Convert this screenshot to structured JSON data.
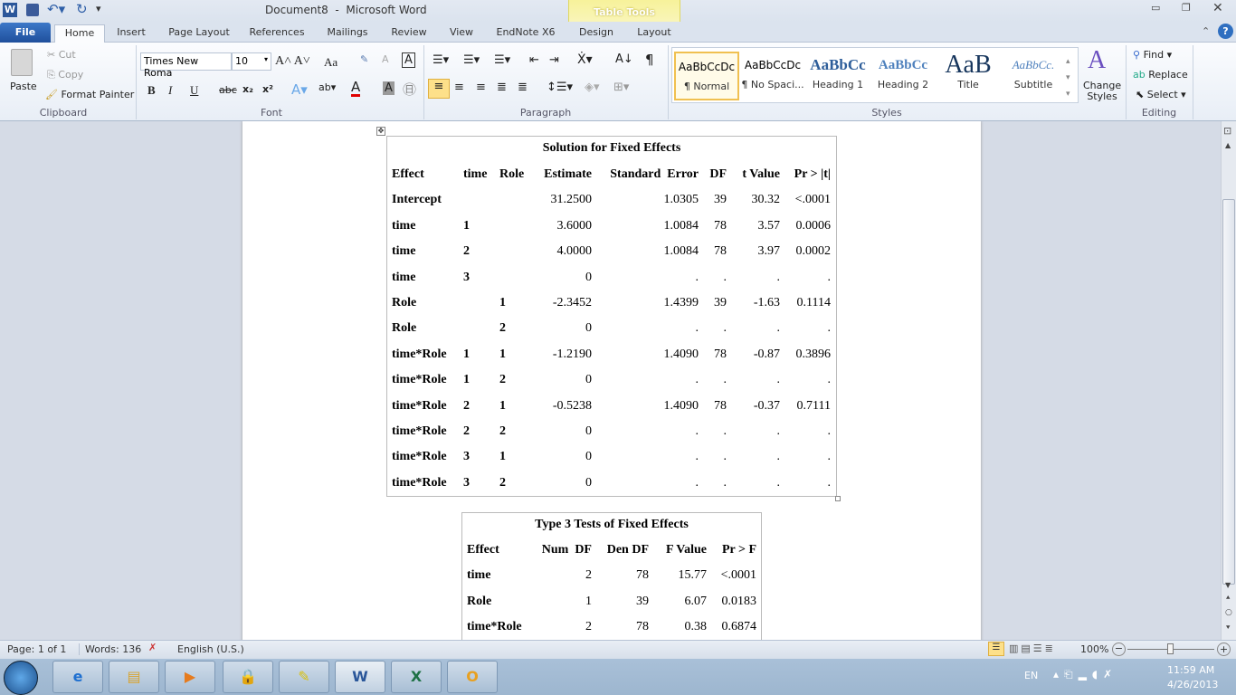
{
  "window": {
    "title": "Document8  -  Microsoft Word",
    "contextual_tab_group": "Table Tools"
  },
  "tabs": [
    "File",
    "Home",
    "Insert",
    "Page Layout",
    "References",
    "Mailings",
    "Review",
    "View",
    "EndNote X6",
    "Design",
    "Layout"
  ],
  "clipboard": {
    "paste": "Paste",
    "cut": "Cut",
    "copy": "Copy",
    "format_painter": "Format Painter",
    "label": "Clipboard"
  },
  "font": {
    "name": "Times New Roma",
    "size": "10",
    "label": "Font",
    "bold": "B",
    "italic": "I",
    "underline": "U",
    "strike": "abc",
    "change_case": "Aa"
  },
  "paragraph": {
    "label": "Paragraph"
  },
  "styles": {
    "items": [
      {
        "preview": "AaBbCcDc",
        "name": "¶ Normal"
      },
      {
        "preview": "AaBbCcDc",
        "name": "¶ No Spaci..."
      },
      {
        "preview": "AaBbCc",
        "name": "Heading 1"
      },
      {
        "preview": "AaBbCc",
        "name": "Heading 2"
      },
      {
        "preview": "AaB",
        "name": "Title"
      },
      {
        "preview": "AaBbCc.",
        "name": "Subtitle"
      }
    ],
    "change_styles": "Change Styles",
    "label": "Styles"
  },
  "editing": {
    "find": "Find",
    "replace": "Replace",
    "select": "Select",
    "label": "Editing"
  },
  "table1": {
    "title": "Solution for Fixed Effects",
    "headers": [
      "Effect",
      "time",
      "Role",
      "Estimate",
      "Standard  Error",
      "DF",
      "t Value",
      "Pr > |t|"
    ],
    "rows": [
      [
        "Intercept",
        "",
        "",
        "31.2500",
        "1.0305",
        "39",
        "30.32",
        "<.0001"
      ],
      [
        "time",
        "1",
        "",
        "3.6000",
        "1.0084",
        "78",
        "3.57",
        "0.0006"
      ],
      [
        "time",
        "2",
        "",
        "4.0000",
        "1.0084",
        "78",
        "3.97",
        "0.0002"
      ],
      [
        "time",
        "3",
        "",
        "0",
        ".",
        ".",
        ".",
        "."
      ],
      [
        "Role",
        "",
        "1",
        "-2.3452",
        "1.4399",
        "39",
        "-1.63",
        "0.1114"
      ],
      [
        "Role",
        "",
        "2",
        "0",
        ".",
        ".",
        ".",
        "."
      ],
      [
        "time*Role",
        "1",
        "1",
        "-1.2190",
        "1.4090",
        "78",
        "-0.87",
        "0.3896"
      ],
      [
        "time*Role",
        "1",
        "2",
        "0",
        ".",
        ".",
        ".",
        "."
      ],
      [
        "time*Role",
        "2",
        "1",
        "-0.5238",
        "1.4090",
        "78",
        "-0.37",
        "0.7111"
      ],
      [
        "time*Role",
        "2",
        "2",
        "0",
        ".",
        ".",
        ".",
        "."
      ],
      [
        "time*Role",
        "3",
        "1",
        "0",
        ".",
        ".",
        ".",
        "."
      ],
      [
        "time*Role",
        "3",
        "2",
        "0",
        ".",
        ".",
        ".",
        "."
      ]
    ]
  },
  "table2": {
    "title": "Type 3 Tests of Fixed Effects",
    "headers": [
      "Effect",
      "Num  DF",
      "Den DF",
      "F Value",
      "Pr > F"
    ],
    "rows": [
      [
        "time",
        "2",
        "78",
        "15.77",
        "<.0001"
      ],
      [
        "Role",
        "1",
        "39",
        "6.07",
        "0.0183"
      ],
      [
        "time*Role",
        "2",
        "78",
        "0.38",
        "0.6874"
      ]
    ]
  },
  "status": {
    "page": "Page: 1 of 1",
    "words": "Words: 136",
    "language": "English (U.S.)",
    "zoom": "100%",
    "zoom_level": 100
  },
  "taskbar": {
    "language": "EN",
    "time": "11:59 AM",
    "date": "4/26/2013"
  },
  "colors": {
    "file_tab": "#2a5ea8",
    "table_tools": "#f5ef8a",
    "accent": "#ffe28a"
  }
}
